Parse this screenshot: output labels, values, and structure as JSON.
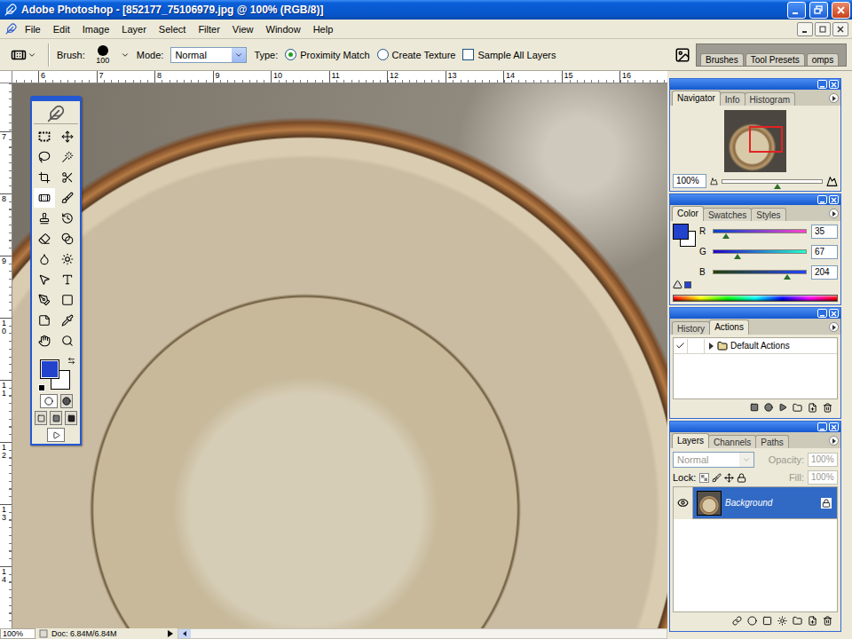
{
  "window": {
    "title": "Adobe Photoshop - [852177_75106979.jpg @ 100% (RGB/8)]"
  },
  "menu": [
    "File",
    "Edit",
    "Image",
    "Layer",
    "Select",
    "Filter",
    "View",
    "Window",
    "Help"
  ],
  "options_bar": {
    "brush_label": "Brush:",
    "brush_size": "100",
    "mode_label": "Mode:",
    "mode": "Normal",
    "type_label": "Type:",
    "type_options": [
      {
        "label": "Proximity Match",
        "selected": true
      },
      {
        "label": "Create Texture",
        "selected": false
      }
    ],
    "sample_all_layers": {
      "label": "Sample All Layers",
      "checked": false
    }
  },
  "palette_well": {
    "tabs": [
      "Brushes",
      "Tool Presets",
      "omps"
    ]
  },
  "rulers": {
    "top": [
      "6",
      "7",
      "8",
      "9",
      "10",
      "11",
      "12",
      "13",
      "14",
      "15",
      "16"
    ],
    "left": [
      "7",
      "8",
      "9",
      "10",
      "11",
      "12",
      "13",
      "14"
    ]
  },
  "toolbox": {
    "tools": [
      {
        "selected": false
      },
      {
        "selected": false
      },
      {
        "selected": false
      },
      {
        "selected": false
      },
      {
        "selected": false
      },
      {
        "selected": false
      },
      {
        "selected": true
      },
      {
        "selected": false
      },
      {
        "selected": false
      },
      {
        "selected": false
      },
      {
        "selected": false
      },
      {
        "selected": false
      },
      {
        "selected": false
      },
      {
        "selected": false
      },
      {
        "selected": false
      },
      {
        "selected": false
      },
      {
        "selected": false
      },
      {
        "selected": false
      },
      {
        "selected": false
      },
      {
        "selected": false
      },
      {
        "selected": false
      },
      {
        "selected": false
      }
    ]
  },
  "navigator": {
    "tabs": [
      {
        "label": "Navigator",
        "selected": true
      },
      {
        "label": "Info",
        "selected": false
      },
      {
        "label": "Histogram",
        "selected": false
      }
    ],
    "zoom": "100%",
    "zoom_level": 0.55
  },
  "color": {
    "tabs": [
      {
        "label": "Color",
        "selected": true
      },
      {
        "label": "Swatches",
        "selected": false
      },
      {
        "label": "Styles",
        "selected": false
      }
    ],
    "channels": [
      {
        "name": "R",
        "value": "35",
        "level": 0.137
      },
      {
        "name": "G",
        "value": "67",
        "level": 0.263
      },
      {
        "name": "B",
        "value": "204",
        "level": 0.8
      }
    ]
  },
  "actions": {
    "tabs": [
      {
        "label": "History",
        "selected": false
      },
      {
        "label": "Actions",
        "selected": true
      }
    ],
    "rows": [
      {
        "label": "Default Actions",
        "checked": true,
        "expanded": false
      }
    ]
  },
  "layers": {
    "tabs": [
      {
        "label": "Layers",
        "selected": true
      },
      {
        "label": "Channels",
        "selected": false
      },
      {
        "label": "Paths",
        "selected": false
      }
    ],
    "blend_mode": {
      "value": "Normal",
      "disabled": true
    },
    "opacity": {
      "label": "Opacity:",
      "value": "100%",
      "disabled": true
    },
    "lock": {
      "label": "Lock:",
      "disabled": false
    },
    "fill": {
      "label": "Fill:",
      "value": "100%",
      "disabled": true
    },
    "items": [
      {
        "name": "Background",
        "visible": true,
        "locked": true,
        "selected": true
      }
    ]
  },
  "status_bar": {
    "zoom": "100%",
    "doc": "Doc: 6.84M/6.84M"
  }
}
